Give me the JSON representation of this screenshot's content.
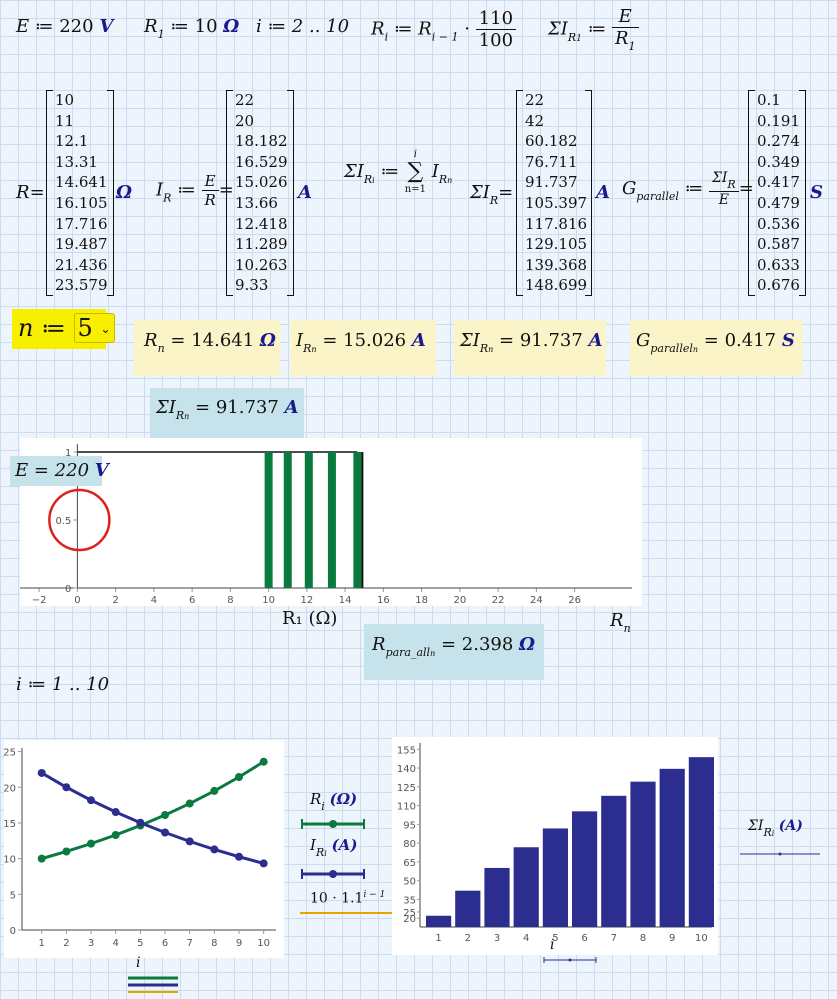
{
  "defs": {
    "E_label": "E",
    "E_op": "≔",
    "E_value": "220",
    "E_unit": "V",
    "R1_label": "R",
    "R1_sub": "1",
    "R1_op": "≔",
    "R1_value": "10",
    "R1_unit": "Ω",
    "i_range": "i ≔ 2 .. 10",
    "Ri_label": "R",
    "Ri_sub": "i",
    "Ri_op": "≔",
    "Ri_prev": "R",
    "Ri_prev_sub": "i − 1",
    "Ri_mul": "·",
    "Ri_num": "110",
    "Ri_den": "100",
    "SIR1_label": "ΣI",
    "SIR1_sub": "R",
    "SIR1_subsub": "1",
    "SIR1_op": "≔",
    "SIR1_num": "E",
    "SIR1_den": "R",
    "SIR1_den_sub": "1"
  },
  "matrices": {
    "R": {
      "label": "R",
      "eq": "=",
      "unit": "Ω",
      "values": [
        "10",
        "11",
        "12.1",
        "13.31",
        "14.641",
        "16.105",
        "17.716",
        "19.487",
        "21.436",
        "23.579"
      ]
    },
    "IR": {
      "label": "I",
      "sub": "R",
      "op": "≔",
      "num": "E",
      "den": "R",
      "eq": "=",
      "unit": "A",
      "values": [
        "22",
        "20",
        "18.182",
        "16.529",
        "15.026",
        "13.66",
        "12.418",
        "11.289",
        "10.263",
        "9.33"
      ]
    },
    "SIRi_def": {
      "label": "ΣI",
      "sub": "R",
      "subsub": "i",
      "op": "≔",
      "sum_top": "i",
      "sum_bottom": "n=1",
      "sum_sign": "∑",
      "term": "I",
      "term_sub": "R",
      "term_subsub": "n"
    },
    "SIR": {
      "label": "ΣI",
      "sub": "R",
      "eq": "=",
      "unit": "A",
      "values": [
        "22",
        "42",
        "60.182",
        "76.711",
        "91.737",
        "105.397",
        "117.816",
        "129.105",
        "139.368",
        "148.699"
      ]
    },
    "G": {
      "label": "G",
      "sub": "parallel",
      "op": "≔",
      "num": "ΣI",
      "num_sub": "R",
      "den": "E",
      "eq": "=",
      "unit": "S",
      "values": [
        "0.1",
        "0.191",
        "0.274",
        "0.349",
        "0.417",
        "0.479",
        "0.536",
        "0.587",
        "0.633",
        "0.676"
      ]
    }
  },
  "selector": {
    "label": "n",
    "op": "≔",
    "value": "5",
    "chevron": "chevron-down-icon"
  },
  "results": {
    "Rn": {
      "label": "R",
      "sub": "n",
      "text": "= 14.641",
      "unit": "Ω"
    },
    "IRn": {
      "label": "I",
      "sub": "R",
      "subsub": "n",
      "text": "= 15.026",
      "unit": "A"
    },
    "SIRn": {
      "label": "ΣI",
      "sub": "R",
      "subsub": "n",
      "text": "= 91.737",
      "unit": "A"
    },
    "Gn": {
      "label": "G",
      "sub": "parallel",
      "subsub": "n",
      "text": "= 0.417",
      "unit": "S"
    },
    "SIRn2": {
      "label": "ΣI",
      "sub": "R",
      "subsub": "n",
      "text": "= 91.737",
      "unit": "A"
    }
  },
  "plot1": {
    "E_text": "E = 220",
    "E_unit": "V",
    "xlabel": "R₁ (Ω)",
    "xlabel2": "R",
    "xlabel2_sub": "n",
    "Rpara_label": "R",
    "Rpara_sub": "para_all",
    "Rpara_subsub": "n",
    "Rpara_text": "= 2.398",
    "Rpara_unit": "Ω",
    "bar_color": "#0a7a3e",
    "circle_color": "#e0201b"
  },
  "i_range2": "i ≔ 1 .. 10",
  "legend": {
    "Ri": "R",
    "Ri_sub": "i",
    "Ri_unit": "(Ω)",
    "IRi": "I",
    "IRi_sub": "R",
    "IRi_subsub": "i",
    "IRi_unit": "(A)",
    "formula": "10 · 1.1",
    "formula_exp": "i − 1",
    "SIRi": "ΣI",
    "SIRi_sub": "R",
    "SIRi_subsub": "i",
    "SIRi_unit": "(A)",
    "xaxis_i": "i",
    "xaxis_i2": "i"
  },
  "colors": {
    "green": "#0a7a3e",
    "navy": "#2b2e8f",
    "orange": "#e6a400",
    "highlight": "#f8ee00"
  },
  "chart_data": [
    {
      "type": "bar",
      "title": "",
      "xlabel": "R₁ (Ω)",
      "ylabel": "",
      "x": [
        10,
        11,
        12.1,
        13.31,
        14.641
      ],
      "values": [
        1,
        1,
        1,
        1,
        1
      ],
      "xlim": [
        -3,
        29
      ],
      "ylim": [
        0,
        1
      ],
      "xticks": [
        "-2",
        "0",
        "2",
        "4",
        "6",
        "8",
        "10",
        "12",
        "14",
        "16",
        "18",
        "20",
        "22",
        "24",
        "26"
      ],
      "yticks": [
        "0",
        "0.5",
        "1"
      ],
      "marker": {
        "n_value": 14.641
      }
    },
    {
      "type": "line",
      "x": [
        1,
        2,
        3,
        4,
        5,
        6,
        7,
        8,
        9,
        10
      ],
      "series": [
        {
          "name": "R_i (Ω)",
          "values": [
            10,
            11,
            12.1,
            13.31,
            14.641,
            16.105,
            17.716,
            19.487,
            21.436,
            23.579
          ]
        },
        {
          "name": "I_Ri (A)",
          "values": [
            22,
            20,
            18.182,
            16.529,
            15.026,
            13.66,
            12.418,
            11.289,
            10.263,
            9.33
          ]
        },
        {
          "name": "10·1.1^(i−1)",
          "values": [
            10,
            11,
            12.1,
            13.31,
            14.641,
            16.105,
            17.716,
            19.487,
            21.436,
            23.579
          ]
        }
      ],
      "xlim": [
        0.2,
        10.5
      ],
      "ylim": [
        0,
        25.5
      ],
      "xticks": [
        "1",
        "2",
        "3",
        "4",
        "5",
        "6",
        "7",
        "8",
        "9",
        "10"
      ],
      "yticks": [
        "0",
        "5",
        "10",
        "15",
        "20",
        "25"
      ]
    },
    {
      "type": "bar",
      "categories": [
        "1",
        "2",
        "3",
        "4",
        "5",
        "6",
        "7",
        "8",
        "9",
        "10"
      ],
      "values": [
        22,
        42,
        60.182,
        76.711,
        91.737,
        105.397,
        117.816,
        129.105,
        139.368,
        148.699
      ],
      "xlabel": "i",
      "ylim": [
        13,
        160
      ],
      "yticks": [
        "20",
        "25",
        "35",
        "50",
        "65",
        "80",
        "95",
        "110",
        "125",
        "140",
        "155"
      ]
    }
  ]
}
